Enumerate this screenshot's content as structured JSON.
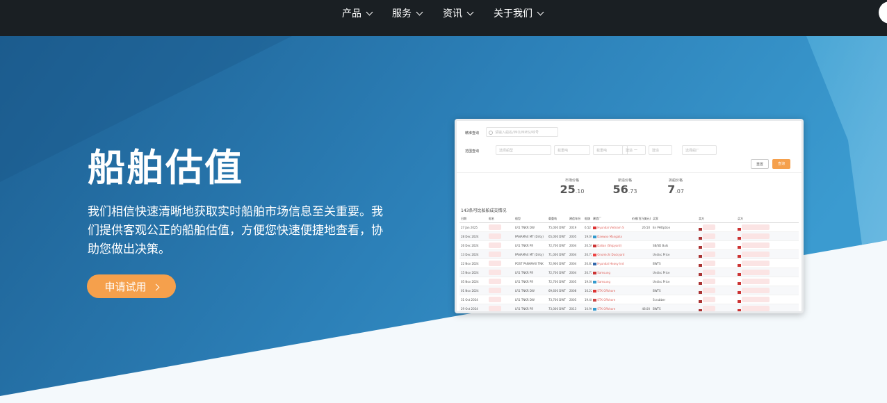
{
  "nav": {
    "items": [
      {
        "label": "产品"
      },
      {
        "label": "服务"
      },
      {
        "label": "资讯"
      },
      {
        "label": "关于我们"
      }
    ]
  },
  "hero": {
    "title": "船舶估值",
    "description": "我们相信快速清晰地获取实时船舶市场信息至关重要。我们提供客观公正的船舶估值，方便您快速便捷地查看，协助您做出决策。",
    "cta_label": "申请试用"
  },
  "preview": {
    "search_label": "精准查询",
    "search_placeholder": "请输入船名/IMO/MMSI/呼号",
    "range_label": "范围查询",
    "range_fields": [
      "选择船型",
      "载重吨",
      "载重吨",
      "建造",
      "建造",
      "选择船厂"
    ],
    "range_dash": "—",
    "reset_label": "重置",
    "query_label": "查询",
    "stats": [
      {
        "label": "市场价格",
        "int": "25",
        "dec": ".10"
      },
      {
        "label": "新造价格",
        "int": "56",
        "dec": ".73"
      },
      {
        "label": "拆船价格",
        "int": "7",
        "dec": ".07"
      }
    ],
    "result_count": "143条可比船舶成交情况",
    "columns": [
      "日期",
      "船名",
      "船型",
      "载重吨",
      "建造年份",
      "船旗",
      "建造厂",
      "价格(百万美元)",
      "买家",
      "卖方",
      "买方"
    ],
    "rows": [
      {
        "date": "27 Jan 2025",
        "type": "LR1 TNKR DW",
        "dwt": "75,000 DWT",
        "year": "2019",
        "age": "6.52",
        "yard": "Hyundai Vietnam S",
        "price": "26.50",
        "buyer": "En PHOption"
      },
      {
        "date": "28 Dec 2024",
        "type": "PANAMAX MT (Dirty)",
        "dwt": "65,000 DWT",
        "year": "2005",
        "age": "19.09",
        "yard": "Daewoo Mangalia",
        "price": "",
        "buyer": ""
      },
      {
        "date": "26 Dec 2024",
        "type": "LR1 TNKR PR",
        "dwt": "72,700 DWT",
        "year": "2004",
        "age": "20.59",
        "yard": "Dalian (Shipyard)",
        "price": "",
        "buyer": "SB/SD Bulk"
      },
      {
        "date": "13 Dec 2024",
        "type": "PANAMAX MT (Dirty)",
        "dwt": "71,000 DWT",
        "year": "2004",
        "age": "20.73",
        "yard": "Onomichi Dockyard",
        "price": "",
        "buyer": "Undisc Price"
      },
      {
        "date": "22 Nov 2024",
        "type": "POST PANAMAX TNK",
        "dwt": "72,900 DWT",
        "year": "2004",
        "age": "20.83",
        "yard": "Hyundai Heavy Ind",
        "price": "",
        "buyer": "BWTS"
      },
      {
        "date": "15 Nov 2024",
        "type": "LR1 TNKR PR",
        "dwt": "72,700 DWT",
        "year": "2004",
        "age": "20.73",
        "yard": "Samsung",
        "price": "",
        "buyer": "Undisc Price"
      },
      {
        "date": "05 Nov 2024",
        "type": "LR1 TNKR PR",
        "dwt": "72,700 DWT",
        "year": "2005",
        "age": "19.08",
        "yard": "Samsung",
        "price": "",
        "buyer": "Undisc Price"
      },
      {
        "date": "01 Nov 2024",
        "type": "LR1 TNKR DW",
        "dwt": "69,600 DWT",
        "year": "2008",
        "age": "16.22",
        "yard": "STX Offshore",
        "price": "",
        "buyer": "BWTS"
      },
      {
        "date": "31 Oct 2024",
        "type": "LR1 TNKR DW",
        "dwt": "73,700 DWT",
        "year": "2005",
        "age": "19.40",
        "yard": "STX Offshore",
        "price": "",
        "buyer": "Scrubber"
      },
      {
        "date": "29 Oct 2024",
        "type": "LR1 TNKR PR",
        "dwt": "73,000 DWT",
        "year": "2013",
        "age": "10.96",
        "yard": "STX Offshore",
        "price": "48.00",
        "buyer": "BWTS"
      }
    ]
  },
  "colors": {
    "nav_bg": "#1a1f23",
    "hero_blue": "#2a7bb0",
    "cta_orange": "#f5a04c",
    "accent_red": "#e0615a"
  }
}
